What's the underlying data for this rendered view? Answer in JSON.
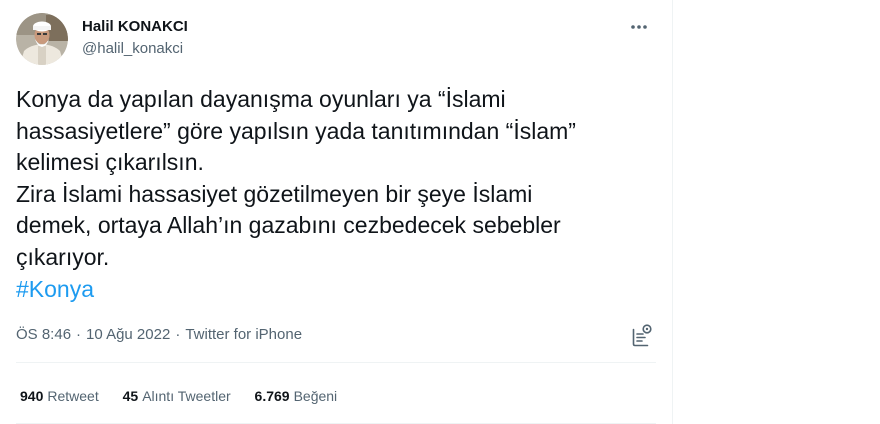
{
  "author": {
    "display_name": "Halil KONAKCI",
    "handle": "@halil_konakci",
    "avatar_icon": "profile-photo"
  },
  "more_icon": "more-horizontal-icon",
  "tweet": {
    "lines": [
      "Konya da yapılan dayanışma oyunları ya “İslami",
      "hassasiyetlere” göre yapılsın yada tanıtımından “İslam”",
      "kelimesi çıkarılsın.",
      "Zira İslami hassasiyet gözetilmeyen bir şeye İslami",
      "demek, ortaya Allah’ın gazabını cezbedecek sebebler",
      "çıkarıyor."
    ],
    "hashtag": "#Konya"
  },
  "meta": {
    "time": "ÖS 8:46",
    "date": "10 Ağu 2022",
    "source": "Twitter for iPhone",
    "separator": "·"
  },
  "analytics_icon": "analytics-icon",
  "stats": {
    "retweets_count": "940",
    "retweets_label": "Retweet",
    "quotes_count": "45",
    "quotes_label": "Alıntı Tweetler",
    "likes_count": "6.769",
    "likes_label": "Beğeni"
  },
  "colors": {
    "text_primary": "#0f1419",
    "text_secondary": "#536471",
    "link": "#1d9bf0",
    "border": "#eff3f4"
  }
}
